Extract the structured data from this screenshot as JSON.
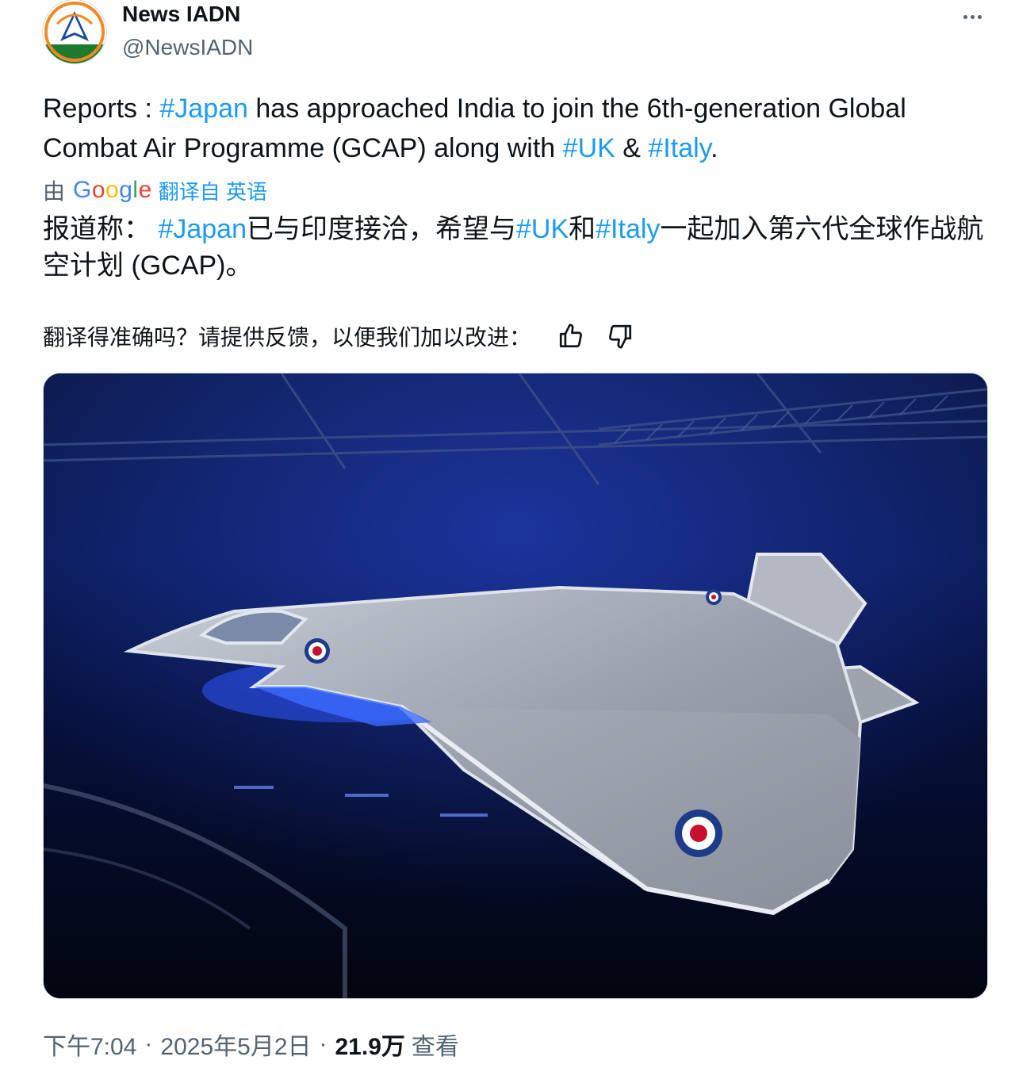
{
  "author": {
    "name": "News IADN",
    "handle": "@NewsIADN"
  },
  "tweet": {
    "parts": {
      "p1": "Reports : ",
      "tag_japan": "#Japan",
      "p2": " has approached India to join the 6th-generation Global Combat Air Programme (GCAP) along with ",
      "tag_uk": "#UK",
      "p3": " & ",
      "tag_italy": "#Italy",
      "p4": "."
    }
  },
  "translation_bar": {
    "by": "由",
    "google": [
      "G",
      "o",
      "o",
      "g",
      "l",
      "e"
    ],
    "from": "翻译自 英语"
  },
  "translation": {
    "p1": "报道称： ",
    "tag_japan": "#Japan",
    "p2": "已与印度接洽，希望与",
    "tag_uk": "#UK",
    "p3": "和",
    "tag_italy": "#Italy",
    "p4": "一起加入第六代全球作战航空计划 (GCAP)。"
  },
  "feedback": {
    "prompt": "翻译得准确吗？请提供反馈，以便我们加以改进："
  },
  "meta": {
    "time": "下午7:04",
    "date": "2025年5月2日",
    "views": "21.9万",
    "views_label": "查看",
    "separator": "·"
  },
  "icons": {
    "more": "more-horizontal-icon",
    "thumbs_up": "thumbs-up-icon",
    "thumbs_down": "thumbs-down-icon"
  },
  "colors": {
    "link": "#1d9bf0",
    "text": "#0f1419",
    "secondary": "#536471"
  }
}
